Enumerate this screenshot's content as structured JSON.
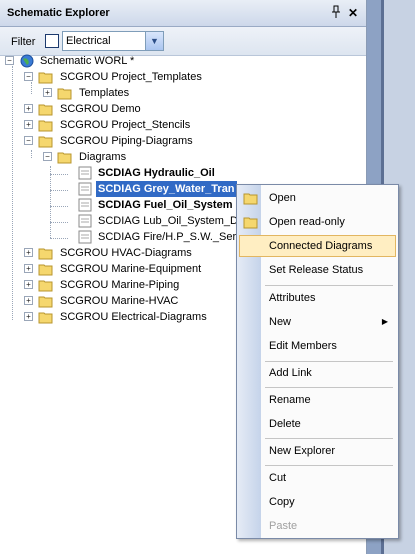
{
  "panel": {
    "title": "Schematic Explorer",
    "pin_icon": "pin-icon",
    "close_label": "✕",
    "filter_label": "Filter",
    "filter_value": "Electrical"
  },
  "tree": {
    "root": "Schematic WORL *",
    "items": [
      {
        "label": "SCGROU Project_Templates"
      },
      {
        "label": "Templates"
      },
      {
        "label": "SCGROU Demo"
      },
      {
        "label": "SCGROU Project_Stencils"
      },
      {
        "label": "SCGROU Piping-Diagrams"
      },
      {
        "label": "Diagrams"
      },
      {
        "label": "SCDIAG Hydraulic_Oil"
      },
      {
        "label": "SCDIAG Grey_Water_Tran"
      },
      {
        "label": "SCDIAG Fuel_Oil_System"
      },
      {
        "label": "SCDIAG Lub_Oil_System_D"
      },
      {
        "label": "SCDIAG Fire/H.P_S.W._Ser"
      },
      {
        "label": "SCGROU HVAC-Diagrams"
      },
      {
        "label": "SCGROU Marine-Equipment"
      },
      {
        "label": "SCGROU Marine-Piping"
      },
      {
        "label": "SCGROU Marine-HVAC"
      },
      {
        "label": "SCGROU Electrical-Diagrams"
      }
    ]
  },
  "context_menu": {
    "open": "Open",
    "open_read_only": "Open read-only",
    "connected_diagrams": "Connected Diagrams",
    "set_release_status": "Set Release Status",
    "attributes": "Attributes",
    "new": "New",
    "edit_members": "Edit Members",
    "add_link": "Add Link",
    "rename": "Rename",
    "delete": "Delete",
    "new_explorer": "New Explorer",
    "cut": "Cut",
    "copy": "Copy",
    "paste": "Paste",
    "submenu_arrow": "▶"
  },
  "colors": {
    "selection": "#316ac5",
    "menu_highlight": "#ffeec2",
    "folder": "#f5d76e"
  }
}
